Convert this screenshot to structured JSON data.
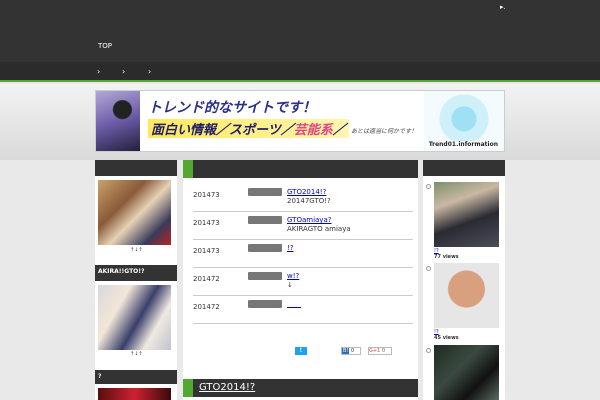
{
  "header": {
    "top_link": "TOP",
    "corner_mark": "▸."
  },
  "nav": {
    "items": [
      "›",
      "›",
      "›"
    ]
  },
  "banner": {
    "line1": "トレンド的なサイトです！",
    "line2_a": "面白い情報／スポーツ／",
    "line2_b": "芸能系",
    "line2_c": "／",
    "line3": "あとは適当に何かです！",
    "brand": "Trend01.information"
  },
  "sidebar": {
    "box1": {
      "caption": "↑↓↑"
    },
    "box2": {
      "header": "AKIRA!!GTO!?",
      "caption": "↑↓↑"
    },
    "box3": {
      "header": "?"
    }
  },
  "main": {
    "rows": [
      {
        "date": "201473",
        "title": "GTO2014!?",
        "excerpt": "20147GTO!?"
      },
      {
        "date": "201473",
        "title": "GTOamiaya?",
        "excerpt": "AKIRAGTO amiaya"
      },
      {
        "date": "201473",
        "title": "!?",
        "excerpt": ""
      },
      {
        "date": "201472",
        "title": "w!?",
        "excerpt": "↓"
      },
      {
        "date": "201472",
        "title": "",
        "excerpt": ""
      }
    ],
    "share": {
      "twitter": "t",
      "hatena": "B!",
      "hatena_count": "0",
      "gplus": "G+1",
      "gplus_count": "0"
    },
    "bottom_title": "GTO2014!?"
  },
  "ranking": {
    "items": [
      {
        "title": "!?",
        "views": "77 views"
      },
      {
        "title": "!?",
        "views": "45 views"
      }
    ]
  }
}
